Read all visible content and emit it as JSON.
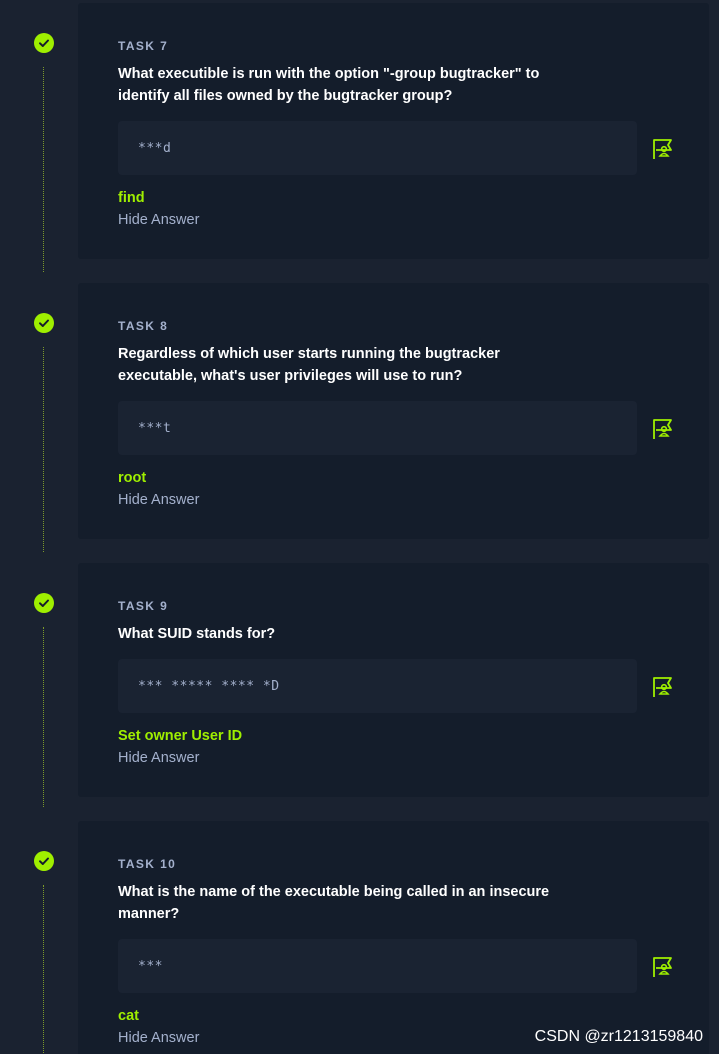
{
  "tasks": [
    {
      "label": "TASK 7",
      "question": "What executible is run with the option \"-group bugtracker\" to identify all files owned by the bugtracker group?",
      "mask": "***d",
      "answer": "find",
      "hide_label": "Hide Answer"
    },
    {
      "label": "TASK 8",
      "question": "Regardless of which user starts running the bugtracker executable, what's user privileges will use to run?",
      "mask": "***t",
      "answer": "root",
      "hide_label": "Hide Answer"
    },
    {
      "label": "TASK 9",
      "question": "What SUID stands for?",
      "mask": "*** ***** **** *D",
      "answer": "Set owner User ID",
      "hide_label": "Hide Answer"
    },
    {
      "label": "TASK 10",
      "question": "What is the name of the executable being called in an insecure manner?",
      "mask": "***",
      "answer": "cat",
      "hide_label": "Hide Answer"
    }
  ],
  "icons": {
    "check": "check-circle-icon",
    "flag": "hint-flag-icon"
  },
  "colors": {
    "accent": "#9fef00",
    "card": "#141d2b",
    "background": "#1a2230",
    "muted": "#a4b1cd"
  },
  "watermark": "CSDN @zr1213159840"
}
